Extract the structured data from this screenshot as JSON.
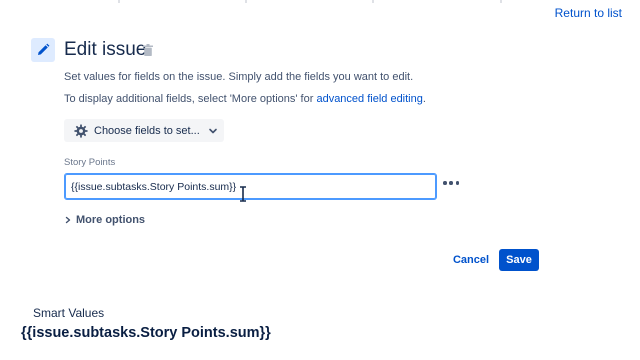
{
  "header": {
    "return_link": "Return to list"
  },
  "editor": {
    "title": "Edit issue",
    "description_1": "Set values for fields on the issue. Simply add the fields you want to edit.",
    "description_2_prefix": "To display additional fields, select 'More options' for ",
    "description_2_link": "advanced field editing",
    "description_2_suffix": ".",
    "choose_fields_label": "Choose fields to set...",
    "field": {
      "label": "Story Points",
      "value": "{{issue.subtasks.Story Points.sum}}"
    },
    "more_options_label": "More options",
    "cancel_label": "Cancel",
    "save_label": "Save"
  },
  "caption": {
    "label": "Smart Values",
    "value": "{{issue.subtasks.Story Points.sum}}"
  },
  "colors": {
    "accent": "#0052cc",
    "focus_border": "#4c9aff",
    "icon_bg": "#deebff",
    "text": "#172b4d",
    "subtle_text": "#42526e"
  },
  "icons": {
    "edit": "pencil-icon",
    "delete": "trash-icon",
    "settings": "gear-icon",
    "dropdown": "chevron-down-icon",
    "expand": "chevron-right-icon",
    "menu": "more-horizontal-icon",
    "text_cursor": "i-beam-cursor-icon"
  }
}
